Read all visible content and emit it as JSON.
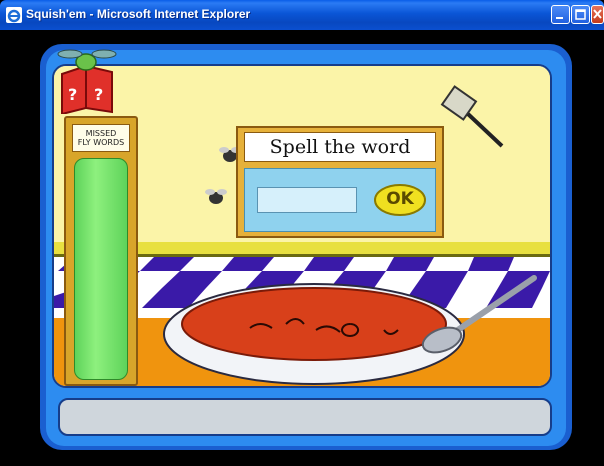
{
  "window": {
    "title": "Squish'em - Microsoft Internet Explorer",
    "controls": [
      "minimize-icon",
      "maximize-icon",
      "close-icon"
    ]
  },
  "game": {
    "missed_words_label_line1": "MISSED",
    "missed_words_label_line2": "FLY WORDS",
    "prompt": "Spell the word",
    "answer_value": "",
    "ok_label": "OK",
    "icons": [
      "help-book-icon",
      "fly-swatter-icon",
      "fly-icon",
      "soup-bowl-icon",
      "spoon-icon"
    ]
  },
  "colors": {
    "titlebar": "#0a55d6",
    "frame_blue": "#1a5fd0",
    "wall": "#fbf4a8",
    "tube_green": "#5ed35a",
    "soup_red": "#d8401a"
  }
}
